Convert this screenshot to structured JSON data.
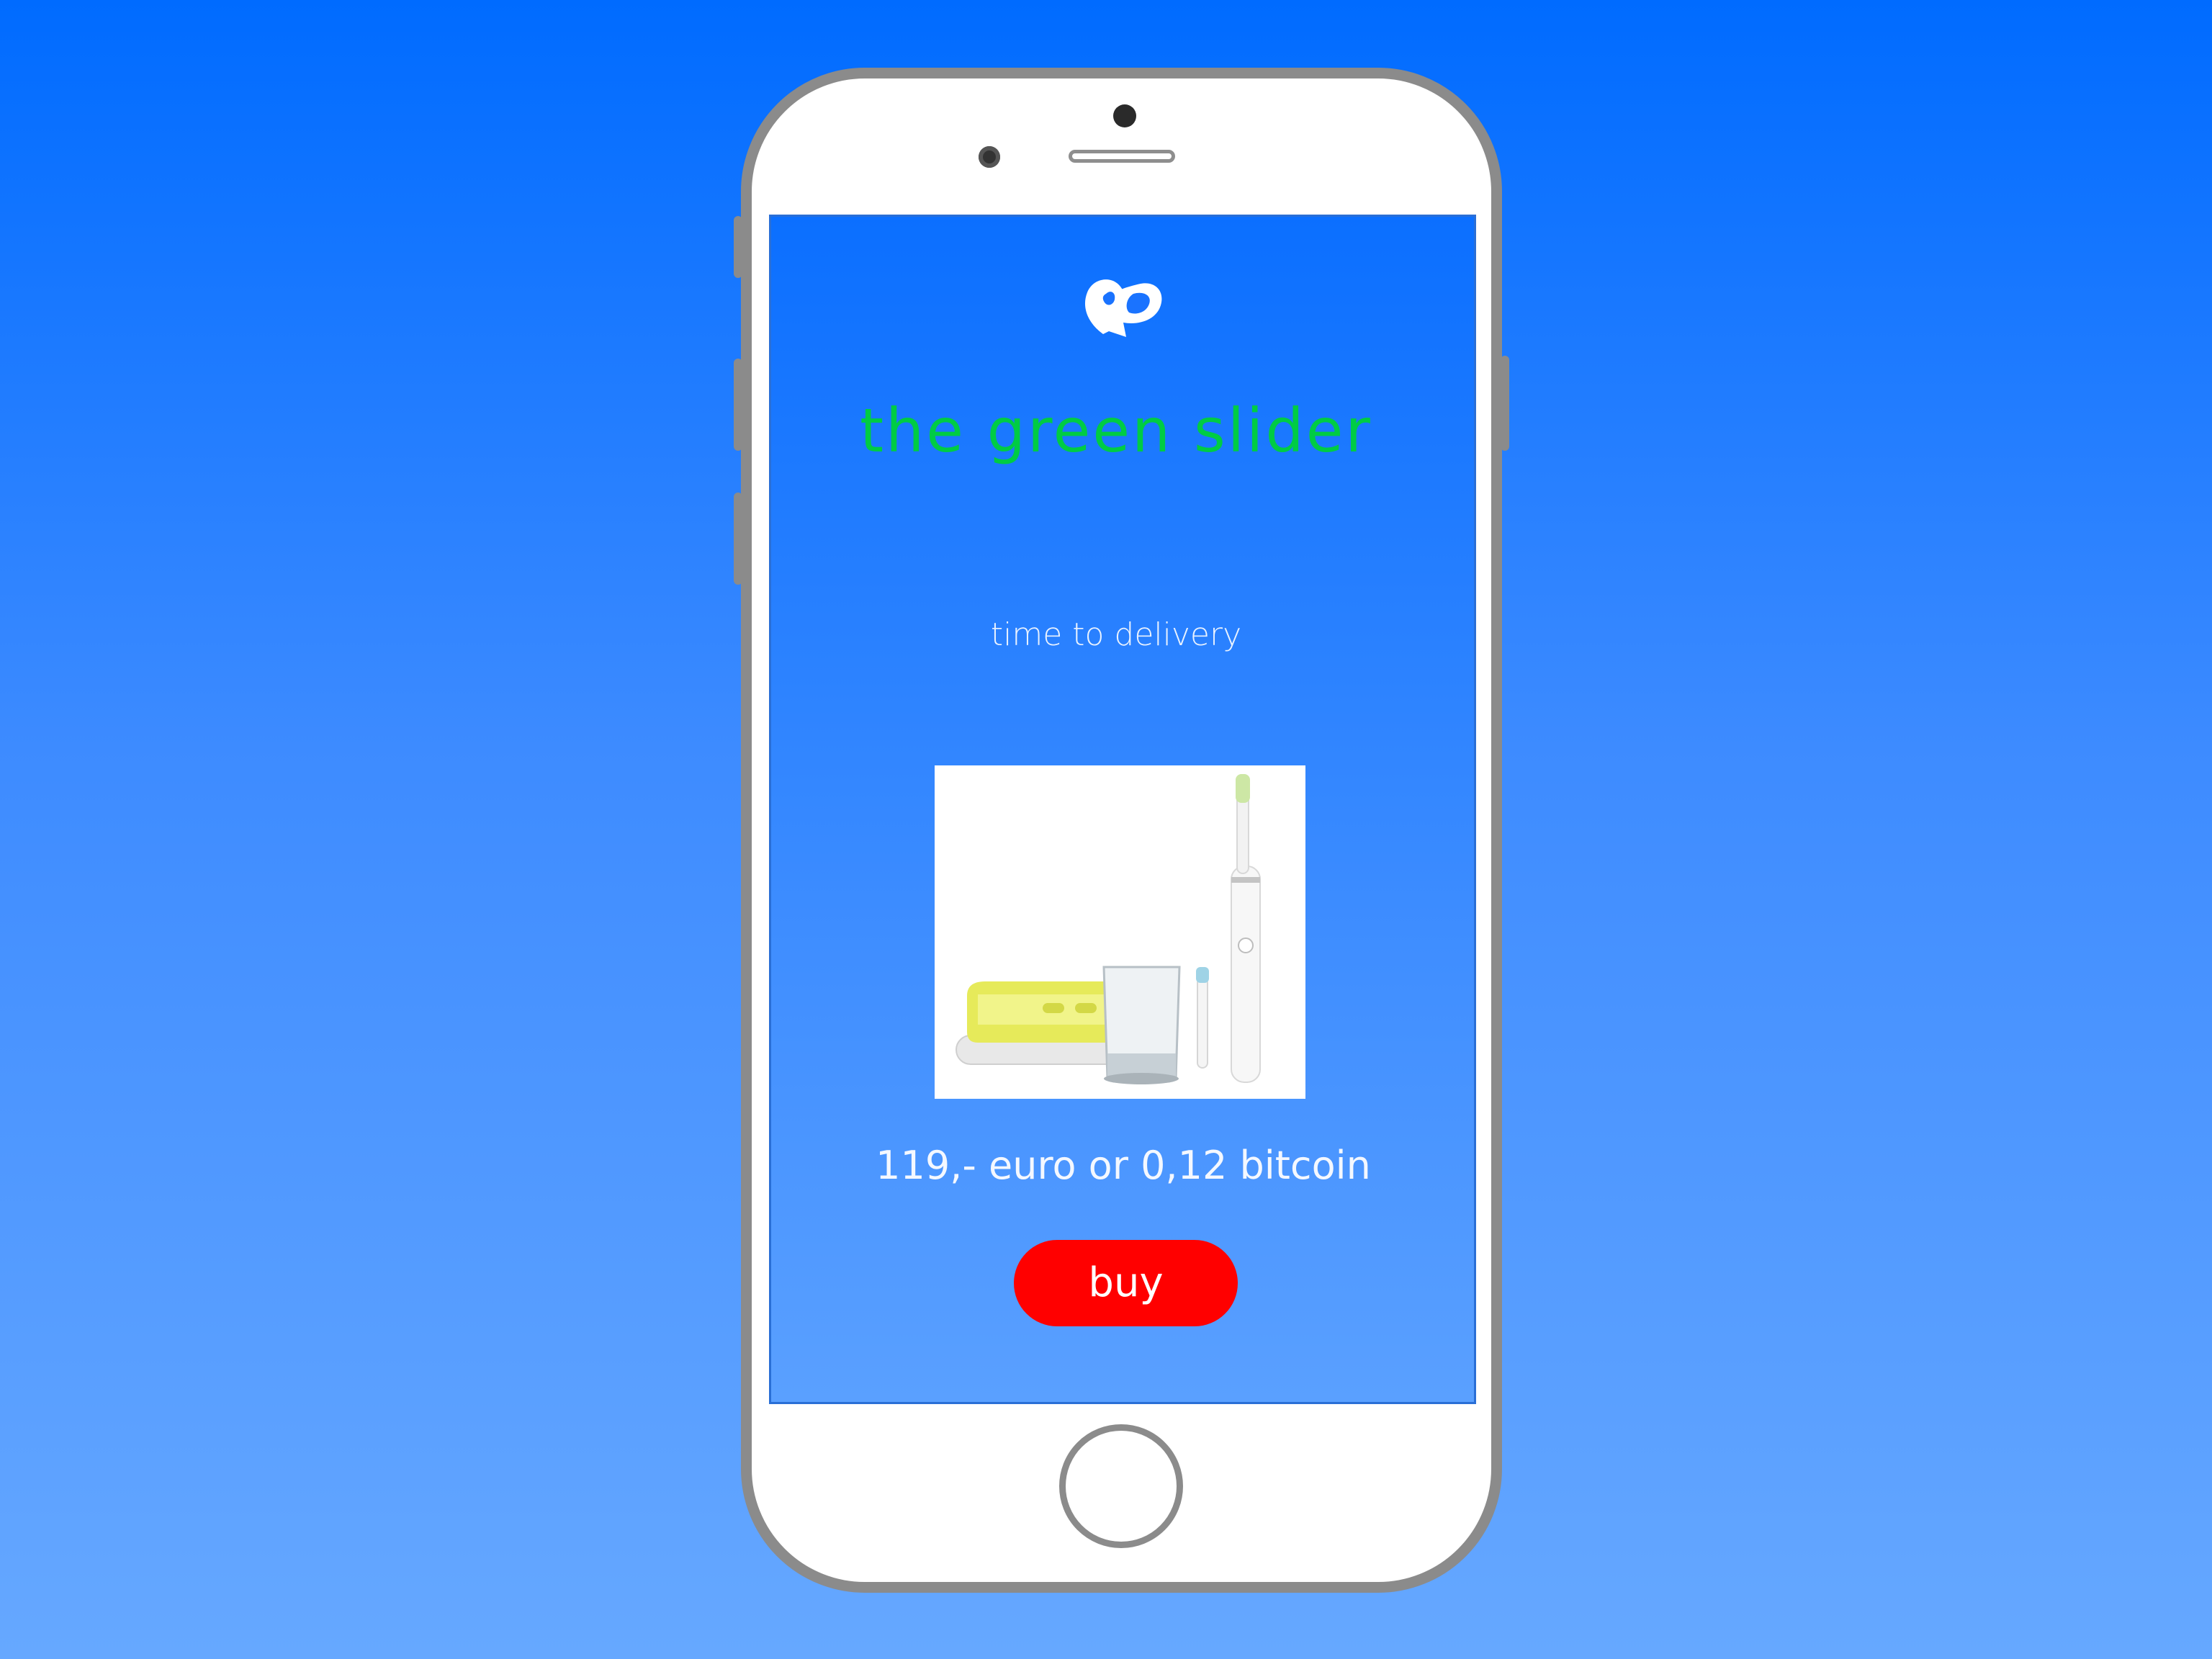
{
  "app": {
    "title": "the green slider",
    "subtitle": "time to delivery"
  },
  "product": {
    "image_icon": "electric-toothbrush-set",
    "price": "119,- euro or 0,12 bitcoin",
    "buy_label": "buy"
  },
  "colors": {
    "background": "#006bff",
    "screen": "#1d7cff",
    "title": "#00cc44",
    "buy_button": "#ff0000",
    "phone_frame": "#8b8b8b"
  },
  "icons": {
    "logo": "loop-logo-icon",
    "home": "home-button"
  }
}
